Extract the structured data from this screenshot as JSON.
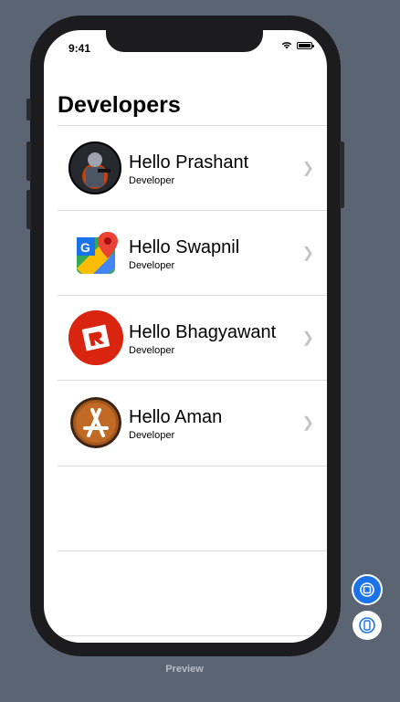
{
  "status_bar": {
    "time": "9:41"
  },
  "nav": {
    "title": "Developers"
  },
  "rows": [
    {
      "name": "Hello Prashant",
      "subtitle": "Developer",
      "icon": "soldier-game-icon"
    },
    {
      "name": "Hello Swapnil",
      "subtitle": "Developer",
      "icon": "maps-icon"
    },
    {
      "name": "Hello Bhagyawant",
      "subtitle": "Developer",
      "icon": "roblox-icon"
    },
    {
      "name": "Hello Aman",
      "subtitle": "Developer",
      "icon": "app-store-icon"
    }
  ],
  "preview": {
    "label": "Preview"
  },
  "colors": {
    "background": "#5b6473",
    "accent": "#1a73e8",
    "divider": "#dcdcdc"
  }
}
